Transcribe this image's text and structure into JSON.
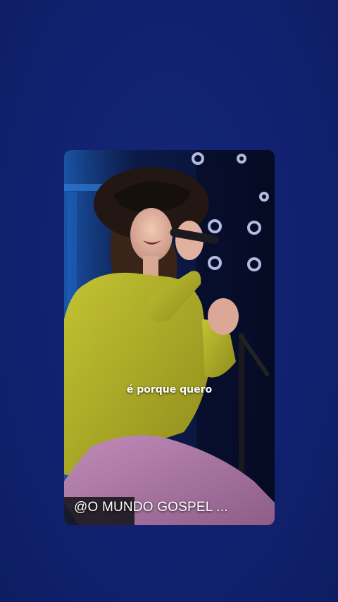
{
  "video": {
    "caption": "é porque quero",
    "handle": "@O MUNDO GOSPEL ..."
  },
  "colors": {
    "background": "#11216b",
    "jacket": "#b7b52a",
    "pants": "#b07aa8",
    "stage_light": "#2f7bd8"
  }
}
